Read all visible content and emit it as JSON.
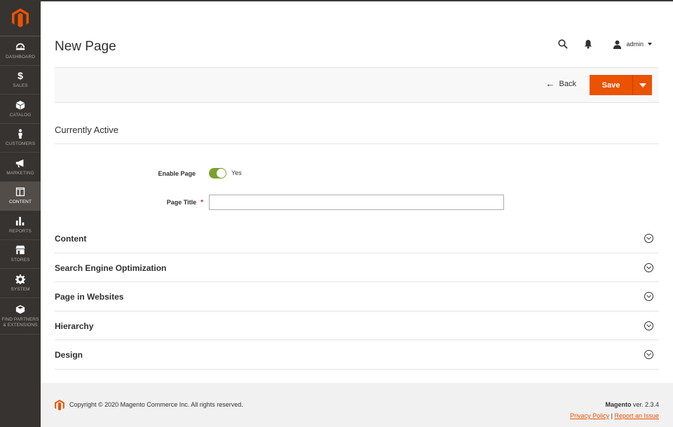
{
  "sidebar": {
    "items": [
      {
        "label": "DASHBOARD",
        "icon": "dashboard-icon"
      },
      {
        "label": "SALES",
        "icon": "dollar-icon"
      },
      {
        "label": "CATALOG",
        "icon": "box-icon"
      },
      {
        "label": "CUSTOMERS",
        "icon": "person-icon"
      },
      {
        "label": "MARKETING",
        "icon": "megaphone-icon"
      },
      {
        "label": "CONTENT",
        "icon": "layout-icon"
      },
      {
        "label": "REPORTS",
        "icon": "bar-chart-icon"
      },
      {
        "label": "STORES",
        "icon": "store-icon"
      },
      {
        "label": "SYSTEM",
        "icon": "gear-icon"
      },
      {
        "label": "FIND PARTNERS & EXTENSIONS",
        "icon": "cube-icon"
      }
    ],
    "active": "CONTENT"
  },
  "header": {
    "title": "New Page",
    "user": "admin"
  },
  "actions": {
    "back_label": "Back",
    "save_label": "Save"
  },
  "form": {
    "section_title": "Currently Active",
    "enable_page_label": "Enable Page",
    "enable_page_value": "Yes",
    "page_title_label": "Page Title",
    "required_mark": "*",
    "page_title_value": ""
  },
  "sections": [
    {
      "title": "Content"
    },
    {
      "title": "Search Engine Optimization"
    },
    {
      "title": "Page in Websites"
    },
    {
      "title": "Hierarchy"
    },
    {
      "title": "Design"
    }
  ],
  "footer": {
    "copyright": "Copyright © 2020 Magento Commerce Inc. All rights reserved.",
    "brand": "Magento",
    "version": "ver. 2.3.4",
    "privacy_label": "Privacy Policy",
    "separator": "|",
    "report_label": "Report an Issue"
  },
  "colors": {
    "sidebar_bg": "#373330",
    "accent": "#eb5202",
    "toggle_on": "#79a22e"
  }
}
